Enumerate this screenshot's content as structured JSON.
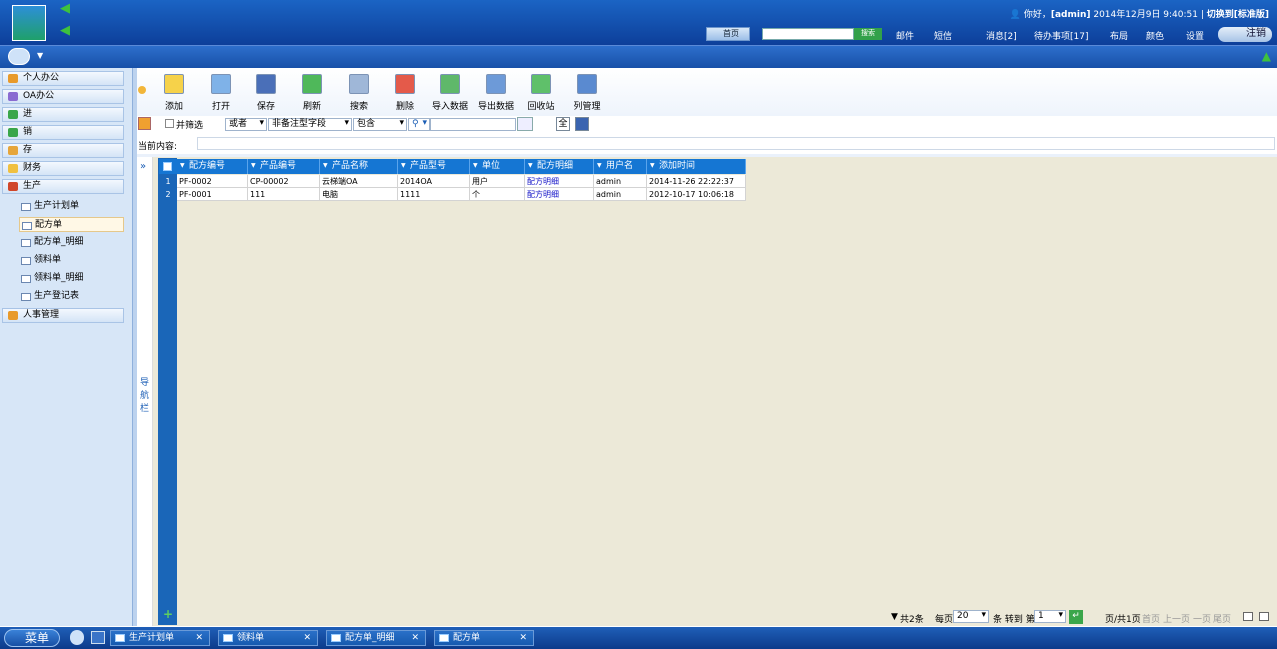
{
  "header": {
    "greeting": "你好，",
    "user": "[admin]",
    "datetime": "2014年12月9日  9:40:51",
    "switch_label": "切换到[标准版]",
    "home": "首页",
    "search_btn": "搜索",
    "nav": [
      "邮件",
      "短信",
      "消息[2]",
      "待办事项[17]",
      "布局",
      "颜色",
      "设置"
    ],
    "logout": "注销"
  },
  "sidebar": {
    "groups": [
      {
        "label": "个人办公",
        "color": "#e89a2b"
      },
      {
        "label": "OA办公",
        "color": "#8a6bd1"
      },
      {
        "label": "进",
        "color": "#3aa64a"
      },
      {
        "label": "销",
        "color": "#3aa64a"
      },
      {
        "label": "存",
        "color": "#e6a53a"
      },
      {
        "label": "财务",
        "color": "#f0c040"
      },
      {
        "label": "生产",
        "color": "#d0462a"
      }
    ],
    "sub_items": [
      "生产计划单",
      "配方单",
      "配方单_明细",
      "领料单",
      "领料单_明细",
      "生产登记表"
    ],
    "active_sub": "配方单",
    "last_group": {
      "label": "人事管理",
      "color": "#e89a2b"
    }
  },
  "toolbar": {
    "buttons": [
      {
        "label": "添加",
        "color": "#f6d24a"
      },
      {
        "label": "打开",
        "color": "#7fb2e8"
      },
      {
        "label": "保存",
        "color": "#4a6fb8"
      },
      {
        "label": "刷新",
        "color": "#4fb85a"
      },
      {
        "label": "搜索",
        "color": "#9fb7d8"
      },
      {
        "label": "删除",
        "color": "#e45a4a"
      },
      {
        "label": "导入数据",
        "color": "#5fb86a"
      },
      {
        "label": "导出数据",
        "color": "#6d9ad8"
      },
      {
        "label": "回收站",
        "color": "#5fc06a"
      },
      {
        "label": "列管理",
        "color": "#5a8ad0"
      }
    ]
  },
  "filter": {
    "combine_label": "并筛选",
    "logic": "或者",
    "field": "非备注型字段",
    "op": "包含",
    "all_btn": "全"
  },
  "current_label": "当前内容:",
  "nav_label": [
    "导",
    "航",
    "栏"
  ],
  "nav_toggle": "»",
  "grid": {
    "columns": [
      "配方编号",
      "产品编号",
      "产品名称",
      "产品型号",
      "单位",
      "配方明细",
      "用户名",
      "添加时间"
    ],
    "rows": [
      [
        "1",
        "PF-0002",
        "CP-00002",
        "云梯端OA",
        "2014OA",
        "用户",
        "配方明细",
        "admin",
        "2014-11-26 22:22:37"
      ],
      [
        "2",
        "PF-0001",
        "111",
        "电脑",
        "1111",
        "个",
        "配方明细",
        "admin",
        "2012-10-17 10:06:18"
      ]
    ]
  },
  "pager": {
    "total": "共2条",
    "per_page_label": "每页",
    "per_page": "20",
    "goto_label": "条 转到 第",
    "page": "1",
    "page_of": "页/共1页",
    "first": "首页",
    "prev": "上一页",
    "next": "一页",
    "last": "尾页"
  },
  "taskbar": {
    "start": "菜单",
    "tasks": [
      "生产计划单",
      "领料单",
      "配方单_明细",
      "配方单"
    ],
    "close": "✕"
  }
}
